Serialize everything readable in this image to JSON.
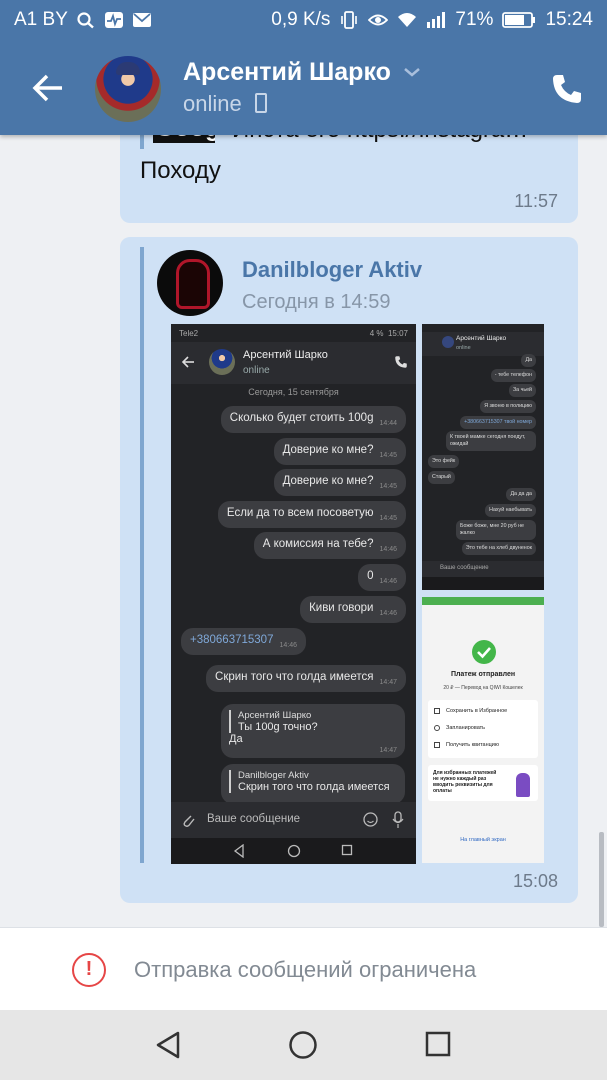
{
  "status_bar": {
    "carrier": "A1 BY",
    "speed": "0,9 K/s",
    "battery": "71%",
    "time": "15:24",
    "icons": [
      "search-icon",
      "activity-icon",
      "mail-icon",
      "vibrate-icon",
      "eye-icon",
      "wifi-icon",
      "signal-icon",
      "battery-icon"
    ]
  },
  "header": {
    "contact_name": "Арсентий Шарко",
    "status": "online",
    "icons": [
      "back-arrow-icon",
      "chevron-down-icon",
      "mobile-icon",
      "phone-icon"
    ]
  },
  "messages": {
    "first": {
      "link_thumb": "Googl",
      "link_text": "Инста его https://instagra…",
      "text": "Походу",
      "time": "11:57"
    },
    "forwarded": {
      "author": "Danilbloger Aktiv",
      "date": "Сегодня в 14:59",
      "time": "15:08",
      "shot1": {
        "status_left": "Tele2",
        "status_right": "4 %",
        "status_time": "15:07",
        "name": "Арсентий Шарко",
        "online": "online",
        "date": "Сегодня, 15 сентября",
        "bubbles": [
          {
            "text": "Сколько будет стоить 100g",
            "time": "14:44"
          },
          {
            "text": "Доверие ко мне?",
            "time": "14:45"
          },
          {
            "text": "Доверие ко мне?",
            "time": "14:45"
          },
          {
            "text": "Если да то всем посоветую",
            "time": "14:45"
          },
          {
            "text": "А комиссия на тебе?",
            "time": "14:46"
          },
          {
            "text": "0",
            "time": "14:46"
          },
          {
            "text": "Киви говори",
            "time": "14:46"
          },
          {
            "text": "+380663715307",
            "time": "14:46"
          },
          {
            "text": "Скрин того что голда имеется",
            "time": "14:47"
          }
        ],
        "reply1": {
          "name": "Арсентий Шарко",
          "quote": "Ты 100g точно?",
          "text": "Да",
          "time": "14:47"
        },
        "reply2": {
          "name": "Danilbloger Aktiv",
          "quote": "Скрин того что голда имеется"
        },
        "input_placeholder": "Ваше сообщение"
      },
      "shot2": {
        "name": "Арсентий Шарко",
        "online": "online",
        "bubbles": [
          "Да",
          "- тебе телефон",
          "За чьей",
          "Я звоню в полицию",
          "+380663715307 твой номер",
          "К твоей мамке сегодня поедут, ожидай",
          "Это фейк",
          "Старый",
          "Да да да",
          "Нахуй наебывать",
          "Боже боже, мне 20 руб не жалко",
          "Это тебе на хлеб двуненок"
        ],
        "input": "Ваше сообщение"
      },
      "shot3": {
        "title": "Платеж отправлен",
        "subtitle": "20 ₽ — Перевод на QIWI Кошелек",
        "rows": [
          "Сохранить в Избранное",
          "Запланировать",
          "Получить квитанцию"
        ],
        "promo": "Для избранных платежей не нужно каждый раз вводить реквизиты для оплаты",
        "link": "На главный экран"
      }
    }
  },
  "restriction": {
    "text": "Отправка сообщений ограничена",
    "icon": "alert-circle-icon"
  },
  "colors": {
    "header_blue": "#4a76a8",
    "bubble": "#cfe1f5",
    "link_blue": "#4a76a8",
    "alert_red": "#e64646"
  }
}
